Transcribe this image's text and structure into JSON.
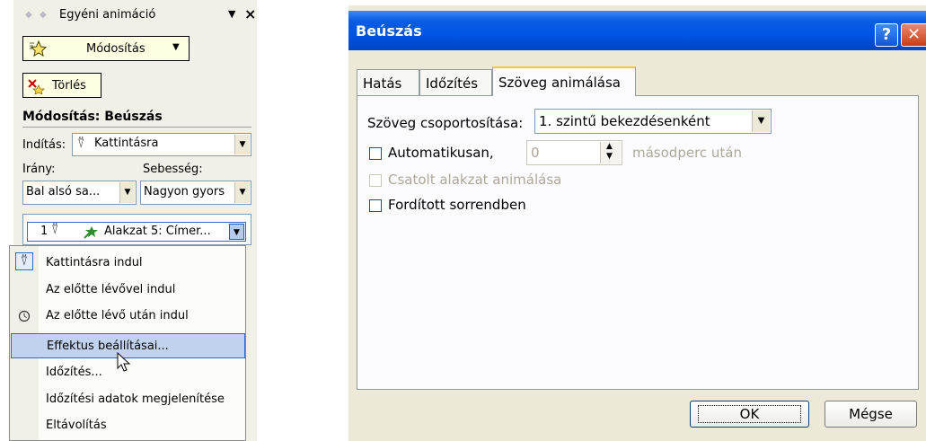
{
  "pane": {
    "title": "Egyéni animáció",
    "change_button": "Módosítás",
    "delete_button": "Törlés",
    "section_title": "Módosítás: Beúszás",
    "start_label": "Indítás:",
    "start_value": "Kattintásra",
    "direction_label": "Irány:",
    "speed_label": "Sebesség:",
    "direction_value": "Bal alsó sa...",
    "speed_value": "Nagyon gyors",
    "item_number": "1",
    "item_label": "Alakzat 5: Címer..."
  },
  "menu": {
    "items": [
      {
        "label": "Kattintásra indul"
      },
      {
        "label": "Az előtte lévővel indul"
      },
      {
        "label": "Az előtte lévő után indul"
      },
      {
        "label": "Effektus beállításai..."
      },
      {
        "label": "Időzítés..."
      },
      {
        "label": "Időzítési adatok megjelenítése"
      },
      {
        "label": "Eltávolítás"
      }
    ],
    "selected_index": 3
  },
  "dialog": {
    "title": "Beúszás",
    "help_glyph": "?",
    "close_glyph": "✕",
    "tabs": [
      "Hatás",
      "Időzítés",
      "Szöveg animálása"
    ],
    "active_tab": 2,
    "group_text_label": "Szöveg csoportosítása:",
    "group_text_value": "1. szintű bekezdésenként",
    "auto_label": "Automatikusan,",
    "auto_value": "0",
    "auto_suffix": "másodperc után",
    "attached_shape_label": "Csatolt alakzat animálása",
    "reverse_label": "Fordított sorrendben",
    "ok_label": "OK",
    "cancel_label": "Mégse"
  }
}
